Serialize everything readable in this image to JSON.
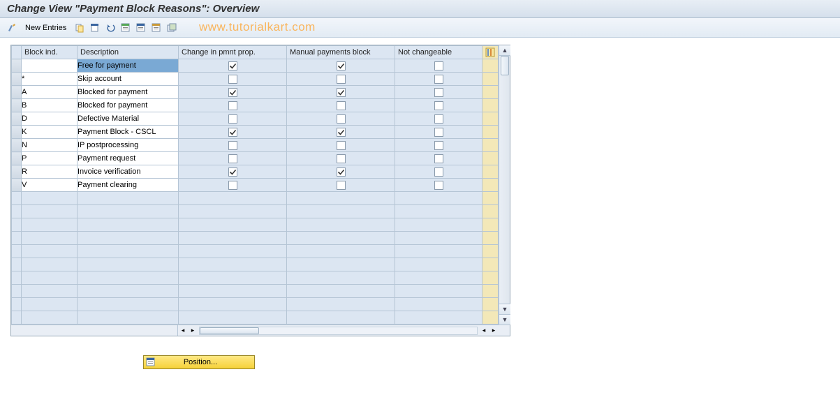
{
  "title": "Change View \"Payment Block Reasons\": Overview",
  "toolbar": {
    "new_entries_label": "New Entries"
  },
  "watermark": "www.tutorialkart.com",
  "columns": {
    "ind": "Block ind.",
    "desc": "Description",
    "prop": "Change in pmnt prop.",
    "man": "Manual payments block",
    "not": "Not changeable"
  },
  "rows": [
    {
      "ind": "",
      "desc": "Free for payment",
      "prop": true,
      "man": true,
      "not": false,
      "selected": true
    },
    {
      "ind": "*",
      "desc": "Skip account",
      "prop": false,
      "man": false,
      "not": false
    },
    {
      "ind": "A",
      "desc": "Blocked for payment",
      "prop": true,
      "man": true,
      "not": false
    },
    {
      "ind": "B",
      "desc": "Blocked for payment",
      "prop": false,
      "man": false,
      "not": false
    },
    {
      "ind": "D",
      "desc": "Defective Material",
      "prop": false,
      "man": false,
      "not": false
    },
    {
      "ind": "K",
      "desc": "Payment Block - CSCL",
      "prop": true,
      "man": true,
      "not": false
    },
    {
      "ind": "N",
      "desc": "IP postprocessing",
      "prop": false,
      "man": false,
      "not": false
    },
    {
      "ind": "P",
      "desc": "Payment request",
      "prop": false,
      "man": false,
      "not": false
    },
    {
      "ind": "R",
      "desc": "Invoice verification",
      "prop": true,
      "man": true,
      "not": false
    },
    {
      "ind": "V",
      "desc": "Payment clearing",
      "prop": false,
      "man": false,
      "not": false
    }
  ],
  "empty_rows": 10,
  "position_button": "Position..."
}
